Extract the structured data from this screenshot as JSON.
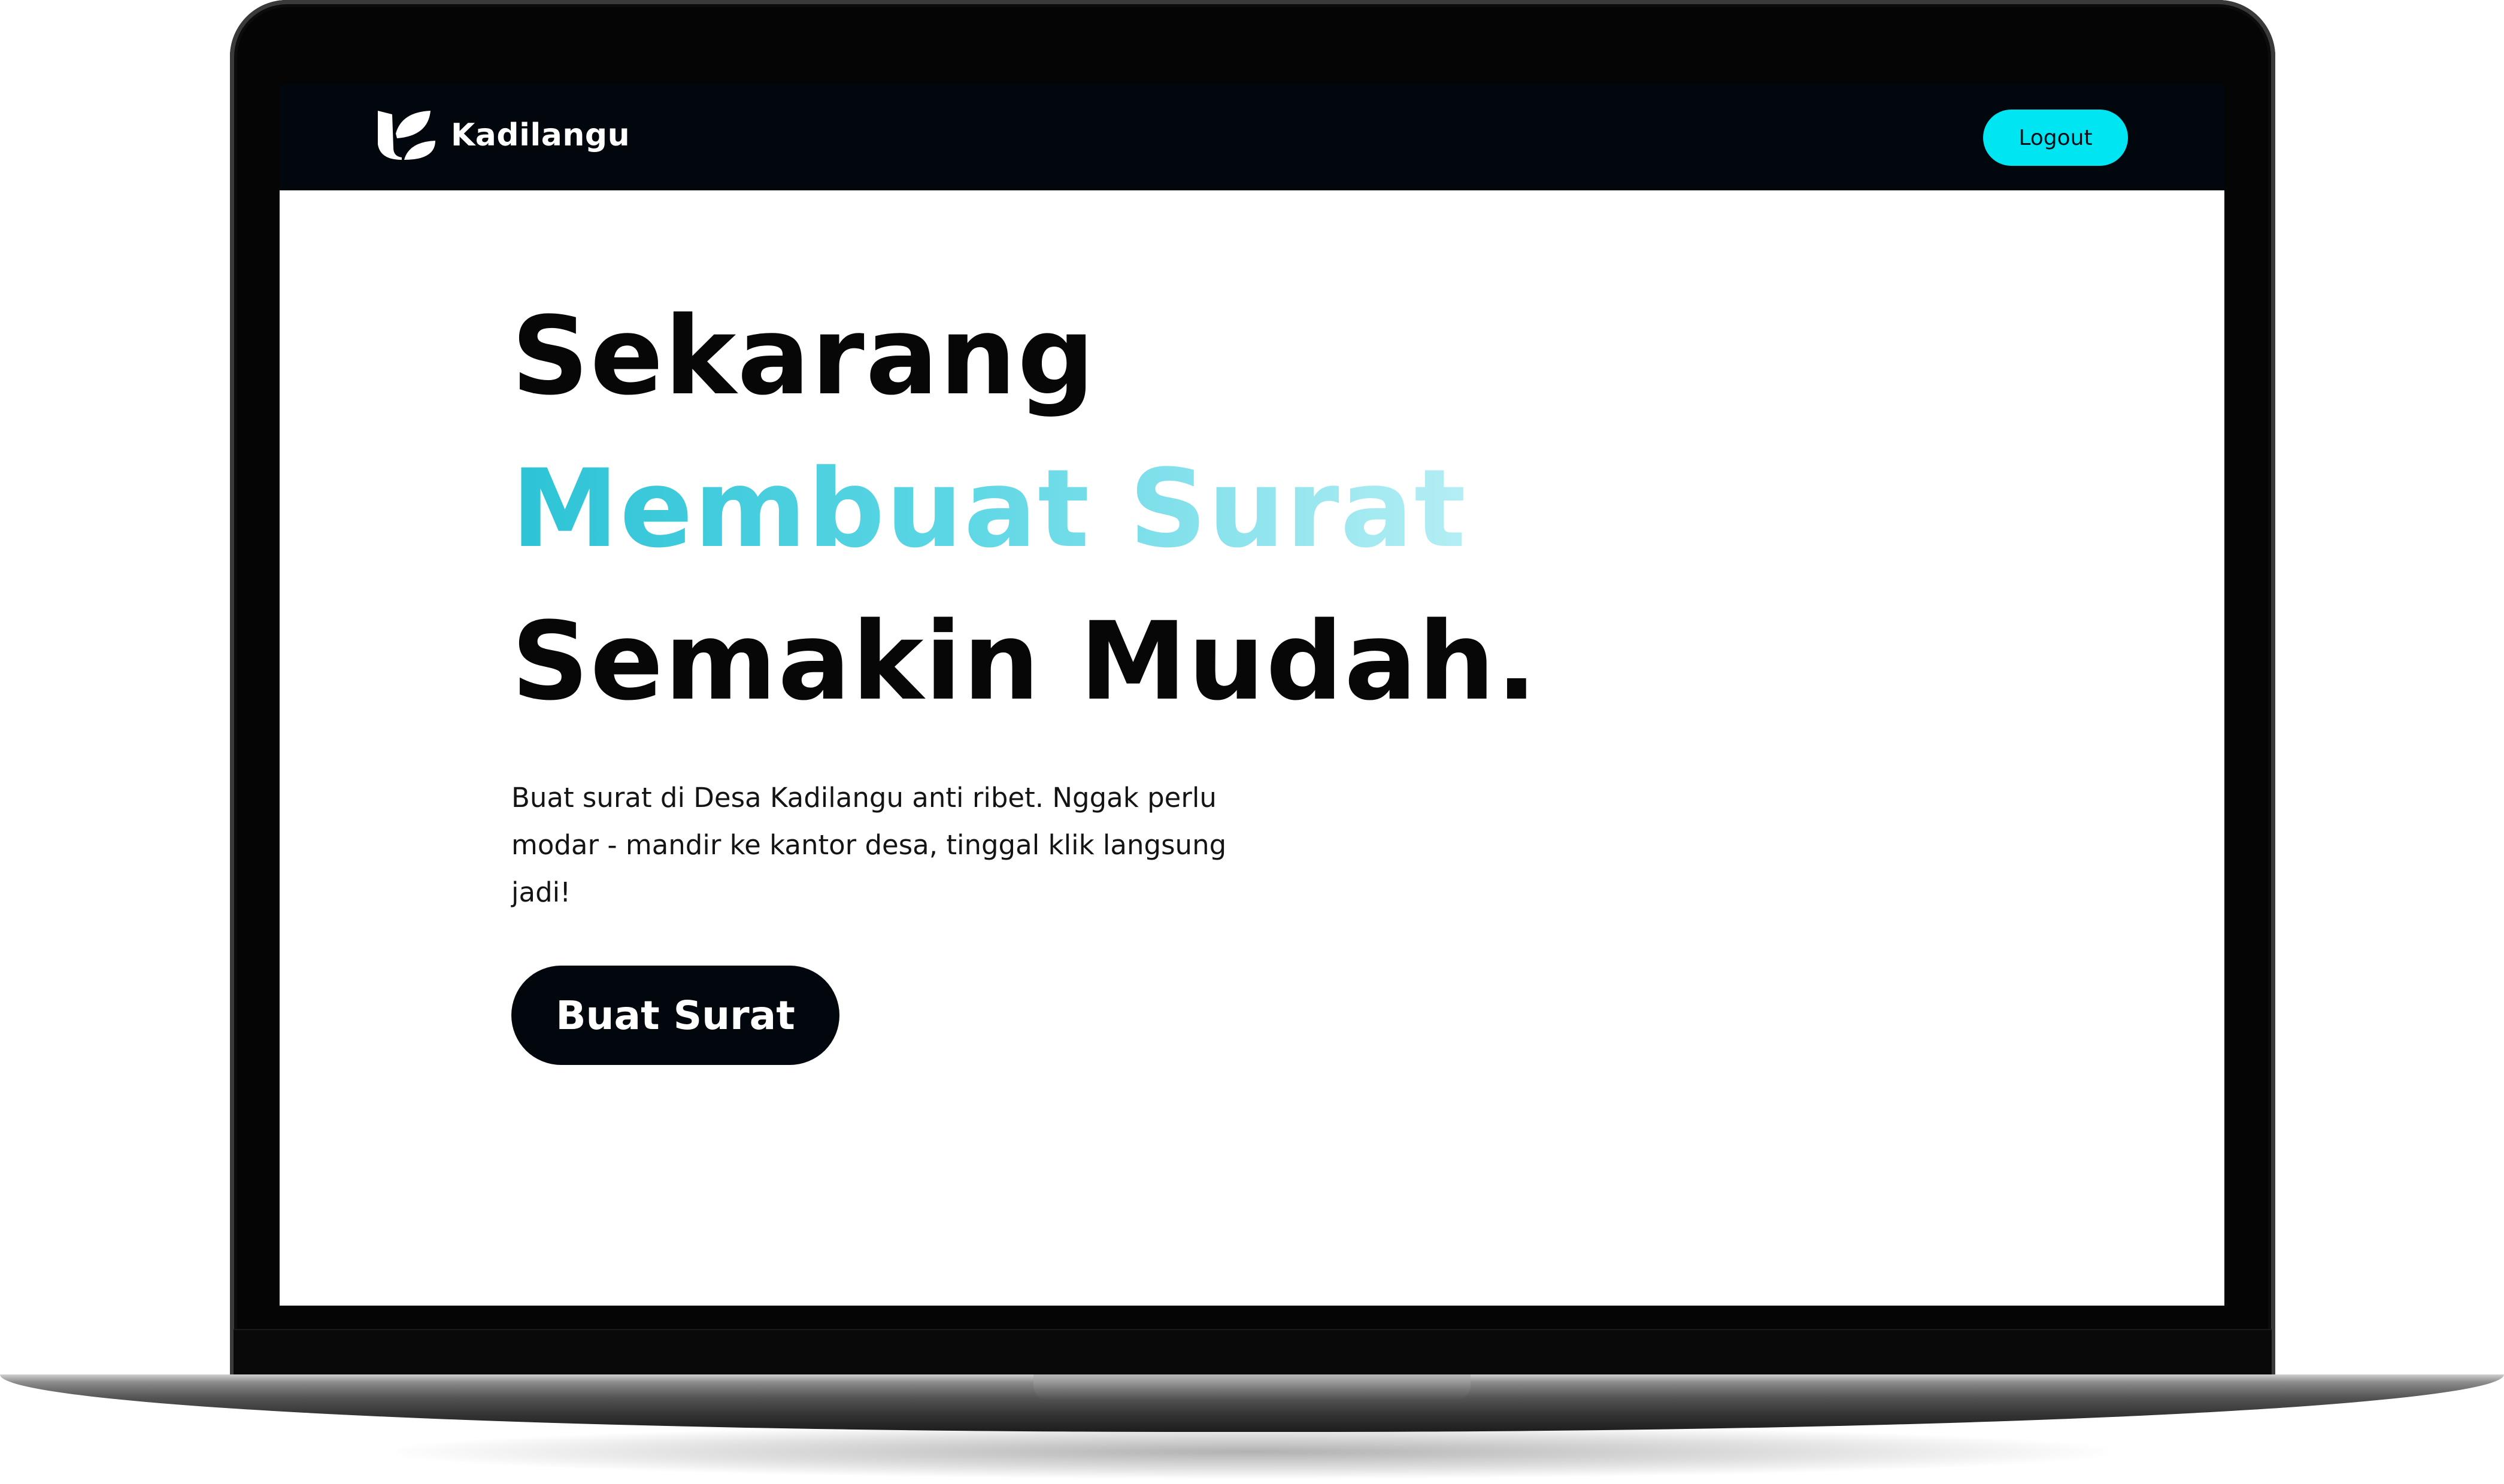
{
  "navbar": {
    "brand_name": "Kadilangu",
    "brand_icon": "kadilangu-leaf-logo",
    "logout_label": "Logout"
  },
  "hero": {
    "headline_line1": "Sekarang",
    "headline_line2": "Membuat Surat",
    "headline_line3": "Semakin Mudah.",
    "description": "Buat surat di Desa Kadilangu anti ribet. Nggak perlu modar - mandir ke kantor desa, tinggal klik langsung jadi!",
    "cta_label": "Buat Surat"
  },
  "colors": {
    "navbar_bg": "#02060d",
    "accent_cyan": "#00e5f2",
    "gradient_start": "#2cc3d6",
    "gradient_end": "#b4eef4",
    "text_dark": "#070707"
  }
}
